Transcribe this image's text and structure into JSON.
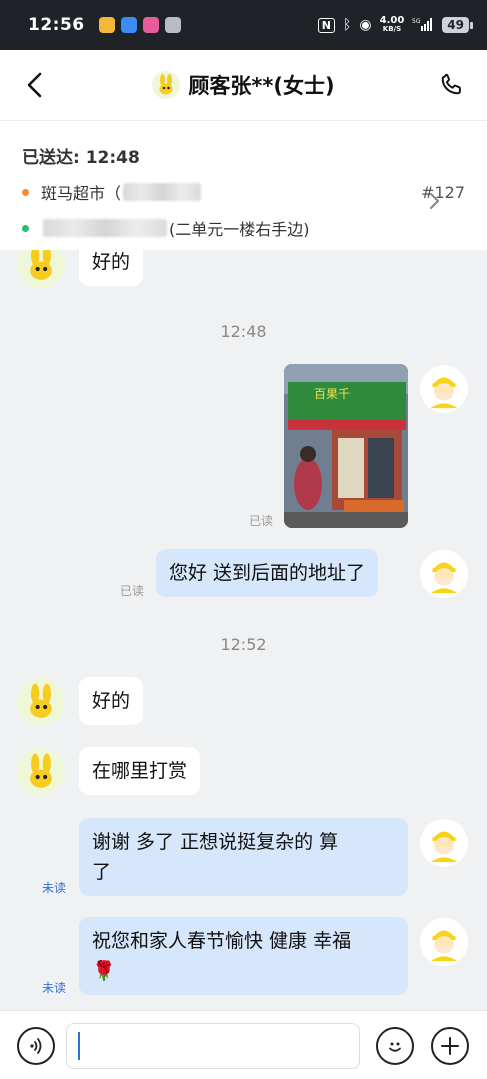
{
  "status_bar": {
    "time": "12:56",
    "speed_value": "4.00",
    "speed_unit": "KB/S",
    "battery": "49"
  },
  "header": {
    "title": "顾客张**(女士)"
  },
  "order": {
    "delivered_label": "已送达: 12:48",
    "store_name": "斑马超市（",
    "order_number": "#127",
    "address_suffix": "(二单元一楼右手边)"
  },
  "chat": {
    "messages": [
      {
        "sender": "customer",
        "text": "好的"
      },
      {
        "type": "time",
        "text": "12:48"
      },
      {
        "sender": "rider",
        "type": "image",
        "status": "已读"
      },
      {
        "sender": "rider",
        "text": "您好  送到后面的地址了",
        "status": "已读"
      },
      {
        "type": "time",
        "text": "12:52"
      },
      {
        "sender": "customer",
        "text": "好的"
      },
      {
        "sender": "customer",
        "text": "在哪里打赏"
      },
      {
        "sender": "rider",
        "text_line1": "谢谢  多了  正想说挺复杂的  算",
        "text_line2": "了",
        "status": "未读"
      },
      {
        "sender": "rider",
        "text_line1": "祝您和家人春节愉快  健康  幸福",
        "text_line2": "🌹",
        "status": "未读"
      }
    ]
  },
  "input": {
    "placeholder": ""
  },
  "colors": {
    "accent": "#2e6fd8",
    "outgoing_bubble": "#d6e6fb",
    "incoming_bubble": "#ffffff",
    "chat_background": "#f0f1f3"
  }
}
